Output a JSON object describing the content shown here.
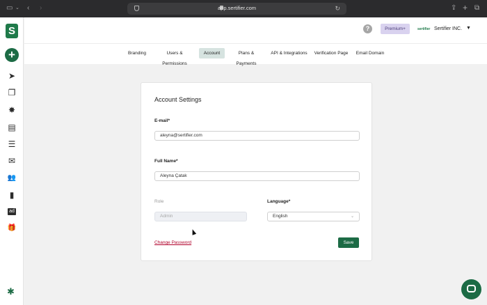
{
  "browser": {
    "url": "app.sertifier.com"
  },
  "sidebar": {
    "logo_letter": "S",
    "add_label": "+",
    "items": [
      {
        "icon": "send-icon",
        "glyph": "➤"
      },
      {
        "icon": "copy-icon",
        "glyph": "❐"
      },
      {
        "icon": "badge-icon",
        "glyph": "✸"
      },
      {
        "icon": "certificate-icon",
        "glyph": "▤"
      },
      {
        "icon": "list-icon",
        "glyph": "☰"
      },
      {
        "icon": "mail-icon",
        "glyph": "✉"
      },
      {
        "icon": "users-icon",
        "glyph": "👥"
      },
      {
        "icon": "chart-icon",
        "glyph": "▮"
      },
      {
        "icon": "ad-icon",
        "glyph": "ad"
      },
      {
        "icon": "gift-icon",
        "glyph": "🎁"
      }
    ],
    "settings_glyph": "✱"
  },
  "header": {
    "help_label": "?",
    "premium_label": "Premium+",
    "org_logo_text": "sertifier",
    "org_name": "Sertifier INC.",
    "caret": "▼"
  },
  "tabs": [
    {
      "label": "Branding",
      "active": false
    },
    {
      "label": "Users & Permissions",
      "active": false
    },
    {
      "label": "Account",
      "active": true
    },
    {
      "label": "Plans & Payments",
      "active": false
    },
    {
      "label": "API & Integrations",
      "active": false
    },
    {
      "label": "Verification Page",
      "active": false
    },
    {
      "label": "Email Domain",
      "active": false
    }
  ],
  "account": {
    "title": "Account Settings",
    "email_label": "E-mail*",
    "email_value": "aleyna@sertifier.com",
    "fullname_label": "Full Name*",
    "fullname_value": "Aleyna Çatak",
    "role_label": "Role",
    "role_value": "Admin",
    "language_label": "Language*",
    "language_value": "English",
    "change_password": "Change Password",
    "save": "Save"
  },
  "colors": {
    "brand_green": "#1c6b45",
    "active_tab_bg": "#d6e3e0",
    "premium_bg": "#d9d2ef",
    "link_red": "#b0002a"
  }
}
